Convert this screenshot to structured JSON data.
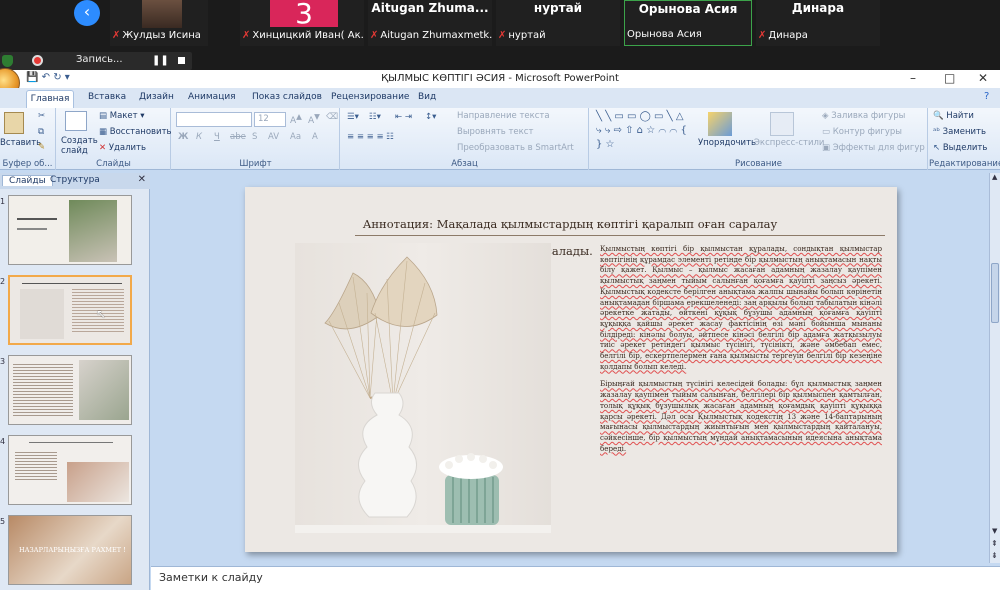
{
  "meeting": {
    "participants": [
      {
        "name": "Жулдыз Исина",
        "muted": true
      },
      {
        "name": "Хинцицкий Иван( Ак...",
        "muted": true,
        "avatar_text": "3"
      },
      {
        "name": "Aitugan Zhumaxmetk...",
        "muted": true,
        "big_name": "Aitugan  Zhuma..."
      },
      {
        "name": "нуртай",
        "muted": true,
        "big_name": "нуртай"
      },
      {
        "name": "Орынова Асия",
        "muted": false,
        "big_name": "Орынова Асия"
      },
      {
        "name": "Динара",
        "muted": true,
        "big_name": "Динара"
      }
    ],
    "recording_label": "Запись..."
  },
  "window": {
    "title": "ҚЫЛМЫС КӨПТІГІ ӘСИЯ - Microsoft PowerPoint",
    "controls": [
      "–",
      "□",
      "✕"
    ]
  },
  "ribbon": {
    "tabs": [
      "Главная",
      "Вставка",
      "Дизайн",
      "Анимация",
      "Показ слайдов",
      "Рецензирование",
      "Вид"
    ],
    "active_tab": "Главная",
    "clipboard": {
      "paste": "Вставить",
      "label": "Буфер об..."
    },
    "slides": {
      "new_slide": "Создать слайд",
      "layout": "Макет",
      "reset": "Восстановить",
      "delete": "Удалить",
      "label": "Слайды"
    },
    "font": {
      "size": "12",
      "label": "Шрифт",
      "buttons": [
        "Ж",
        "К",
        "Ч",
        "abe",
        "S",
        "AV",
        "Aa",
        "A"
      ]
    },
    "paragraph": {
      "text_direction": "Направление текста",
      "align_text": "Выровнять текст",
      "smartart": "Преобразовать в SmartArt",
      "label": "Абзац"
    },
    "drawing": {
      "arrange": "Упорядочить",
      "quick_styles": "Экспресс-стили",
      "fill": "Заливка фигуры",
      "outline": "Контур фигуры",
      "effects": "Эффекты для фигур",
      "label": "Рисование"
    },
    "editing": {
      "find": "Найти",
      "replace": "Заменить",
      "select": "Выделить",
      "label": "Редактирование"
    }
  },
  "pane": {
    "tabs": [
      "Слайды",
      "Структура"
    ],
    "slide_numbers": [
      "1",
      "2",
      "3",
      "4",
      "5"
    ],
    "thanks_text": "НАЗАРЛАРЫҢЫЗҒА РАХМЕТ !"
  },
  "slide": {
    "title": "Аннотация: Мақалада қылмыстардың көптігі қаралып оған саралау",
    "title_tail": "жасалады.",
    "paragraph1": "Қылмыстың көптігі бір қылмыстан құралады, сондықтан қылмыстар көптігінің құрамдас элементі ретінде бір қылмыстың анықтамасын нақты білу қажет. Қылмыс – қылмыс жасаған адамның жазалау қаупімен қылмыстық заңмен тыйым салынған қоғамға қауіпті заңсыз әрекеті. Қылмыстық кодексте берілген анықтама жалпы шынайы болып көрінетін анықтамадан біршама ерекшеленеді: заң арқылы болып табылатын кінәлі әрекетке жатады, өйткені құқық бұзушы адамның қоғамға қауіпті құқыққа қайшы әрекет жасау фактісінің өзі мәні бойынша мынаны білдіреді: кінәлы болуы, әйтпесе кінәсі белгілі бір адамға жатқызылуы тиіс әрекет ретіндегі қылмыс түсінігі, түсінікті, және әмбебап емес, белгілі бір, ескертпелермен ғана қылмысты тергеуін белгілі бір кезеңіне қолдапы болып келеді.",
    "paragraph2": "Бірыңғай қылмыстың түсінігі келесідей болады: бұл қылмыстық заңмен жазалау қаупімен тыйым салынған, белгілері бір қылмыспен қамтылған, толық құқық бұзушылық жасаған адамның қоғамдық қауіпті құқыққа қарсы әрекеті. Дәл осы Қылмыстық кодекстің 13 және 14-баптарының мағынасы қылмыстардың жиынтығын мен қылмыстардың қайталануы, сәйкесінше, бір қылмыстың мұндай анықтамасының идеясына анықтама береді."
  },
  "notes": {
    "placeholder": "Заметки к слайду"
  }
}
